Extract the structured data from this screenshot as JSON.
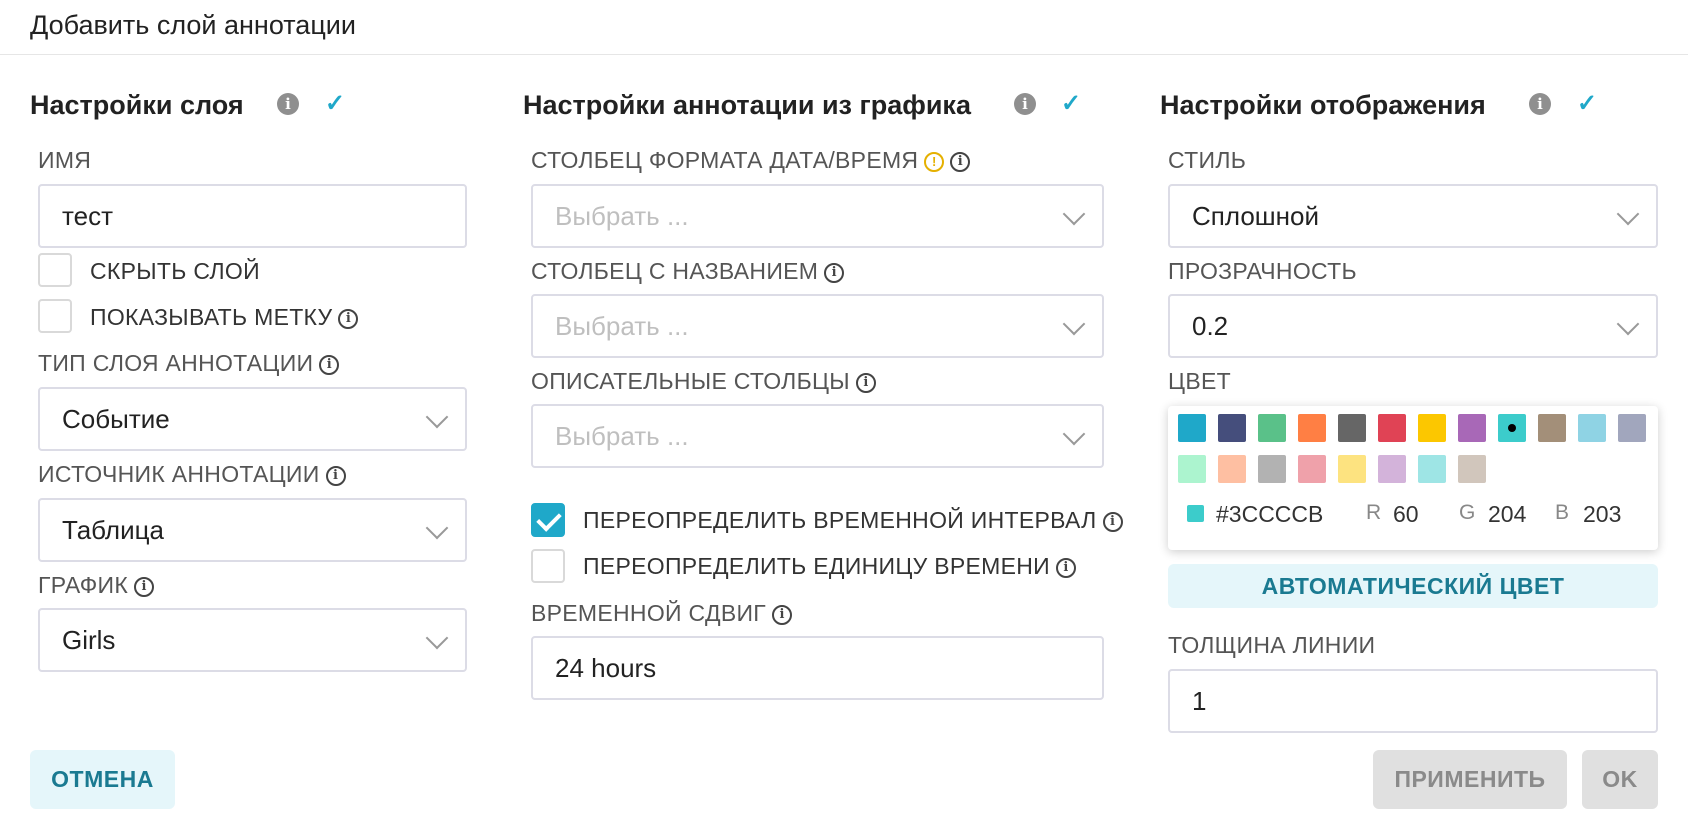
{
  "modal": {
    "title": "Добавить слой аннотации"
  },
  "layer_settings": {
    "title": "Настройки слоя",
    "name_label": "ИМЯ",
    "name_value": "тест",
    "hide_layer_label": "СКРЫТЬ СЛОЙ",
    "hide_layer_checked": false,
    "show_label_label": "ПОКАЗЫВАТЬ МЕТКУ",
    "show_label_checked": false,
    "layer_type_label": "ТИП СЛОЯ АННОТАЦИИ",
    "layer_type_value": "Событие",
    "source_label": "ИСТОЧНИК АННОТАЦИИ",
    "source_value": "Таблица",
    "chart_label": "ГРАФИК",
    "chart_value": "Girls"
  },
  "annotation_settings": {
    "title": "Настройки аннотации из графика",
    "datetime_col_label": "СТОЛБЕЦ ФОРМАТА ДАТА/ВРЕМЯ",
    "datetime_col_placeholder": "Выбрать ...",
    "title_col_label": "СТОЛБЕЦ С НАЗВАНИЕМ",
    "title_col_placeholder": "Выбрать ...",
    "desc_cols_label": "ОПИСАТЕЛЬНЫЕ СТОЛБЦЫ",
    "desc_cols_placeholder": "Выбрать ...",
    "override_range_label": "ПЕРЕОПРЕДЕЛИТЬ ВРЕМЕННОЙ ИНТЕРВАЛ",
    "override_range_checked": true,
    "override_grain_label": "ПЕРЕОПРЕДЕЛИТЬ ЕДИНИЦУ ВРЕМЕНИ",
    "override_grain_checked": false,
    "time_shift_label": "ВРЕМЕННОЙ СДВИГ",
    "time_shift_value": "24 hours"
  },
  "display_settings": {
    "title": "Настройки отображения",
    "style_label": "СТИЛЬ",
    "style_value": "Сплошной",
    "opacity_label": "ПРОЗРАЧНОСТЬ",
    "opacity_value": "0.2",
    "color_label": "ЦВЕТ",
    "palette": [
      "#1fa8c9",
      "#454e7c",
      "#5ac189",
      "#ff7f44",
      "#666666",
      "#e04355",
      "#fcc700",
      "#a868b7",
      "#3ccccb",
      "#a38f79",
      "#8fd3e4",
      "#a1a6bd",
      "#acf4cf",
      "#febfa2",
      "#b2b2b2",
      "#efa1aa",
      "#fde380",
      "#d3b3da",
      "#9ee5e5",
      "#d1c6bc"
    ],
    "selected_color": "#3CCCCB",
    "hex_value": "#3CCCCB",
    "r_label": "R",
    "r_value": "60",
    "g_label": "G",
    "g_value": "204",
    "b_label": "B",
    "b_value": "203",
    "auto_color_label": "АВТОМАТИЧЕСКИЙ ЦВЕТ",
    "line_width_label": "ТОЛЩИНА ЛИНИИ",
    "line_width_value": "1"
  },
  "footer": {
    "cancel_label": "ОТМЕНА",
    "apply_label": "ПРИМЕНИТЬ",
    "ok_label": "OK"
  },
  "icons": {
    "info_dark": "info-filled-icon",
    "info_outline": "info-outline-icon",
    "warning": "warning-icon",
    "check": "check-icon",
    "chevron": "chevron-down-icon"
  }
}
